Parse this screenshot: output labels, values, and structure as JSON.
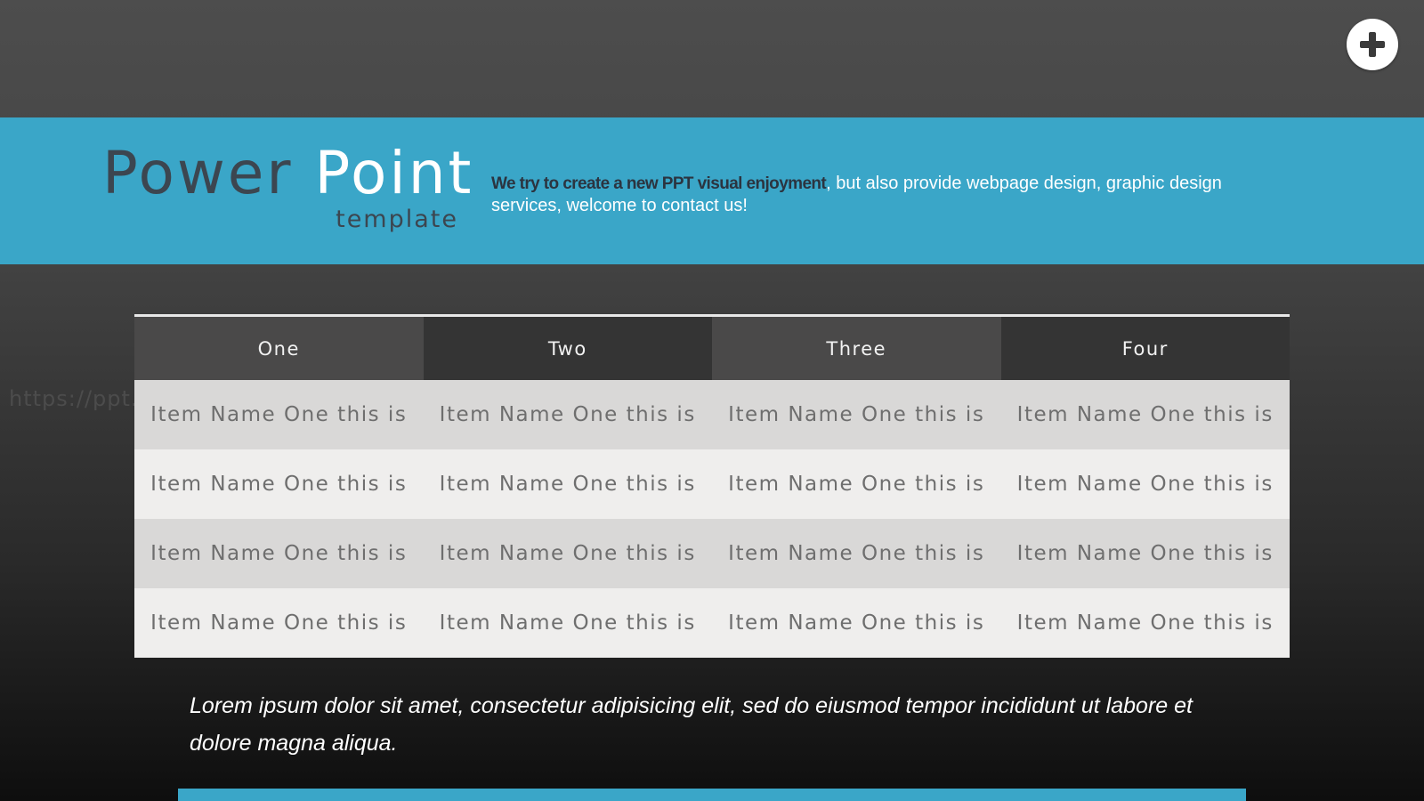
{
  "brand": {
    "title_word1": "Power",
    "title_word2": "Point",
    "subtitle": "template"
  },
  "tagline": {
    "bold_part": "We try to create a new PPT visual enjoyment",
    "rest": ", but also provide webpage design, graphic design services, welcome to contact us!"
  },
  "table": {
    "headers": [
      "One",
      "Two",
      "Three",
      "Four"
    ],
    "rows": [
      [
        "Item Name One this is",
        "Item Name One this is",
        "Item Name One this is",
        "Item Name One this is"
      ],
      [
        "Item Name One this is",
        "Item Name One this is",
        "Item Name One this is",
        "Item Name One this is"
      ],
      [
        "Item Name One this is",
        "Item Name One this is",
        "Item Name One this is",
        "Item Name One this is"
      ],
      [
        "Item Name One this is",
        "Item Name One this is",
        "Item Name One this is",
        "Item Name One this is"
      ]
    ]
  },
  "watermark": "https://ppt.pkll.de",
  "footer": {
    "text": "Lorem ipsum dolor sit amet, consectetur adipisicing elit, sed do eiusmod tempor incididunt ut labore et dolore magna aliqua."
  },
  "icons": {
    "add_button": "plus-icon"
  },
  "colors": {
    "accent": "#3aa6c8",
    "header_dark": "#343434",
    "header_mid": "#4a4949"
  }
}
